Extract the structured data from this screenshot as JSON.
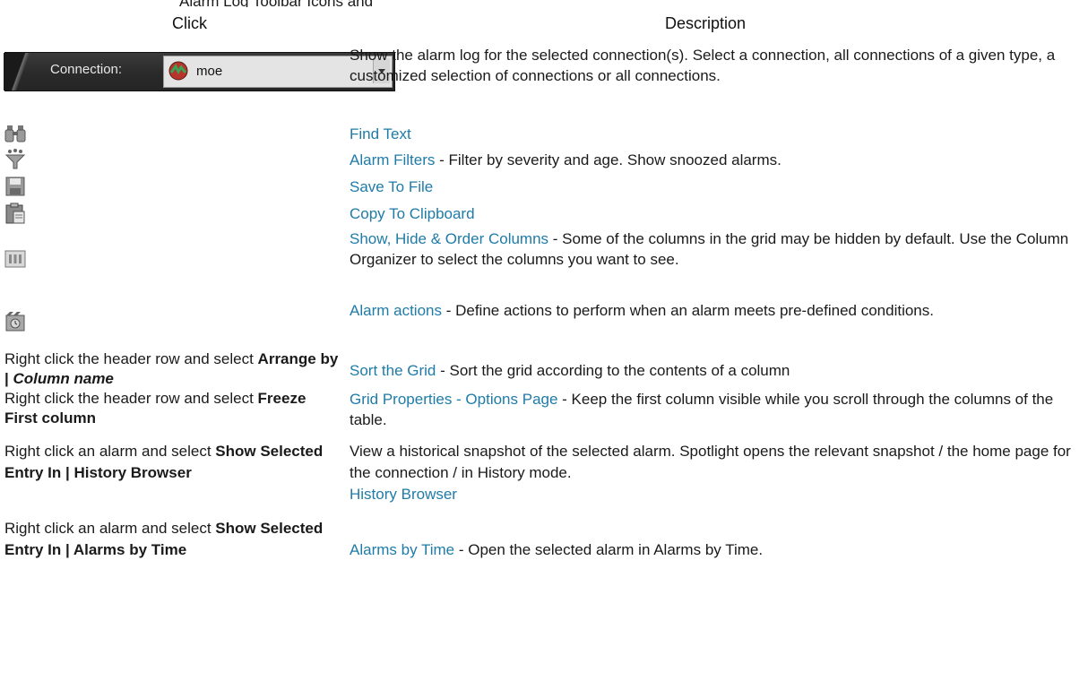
{
  "top_partial_text": "Alarm Log Toolbar Icons and Right-Click Actions",
  "headers": {
    "click": "Click",
    "description": "Description"
  },
  "connection": {
    "label": "Connection:",
    "value": "moe"
  },
  "rows": {
    "r0": {
      "desc": "Show the alarm log for the selected connection(s). Select a connection, all connections of a given type, a customized selection of connections or all connections."
    },
    "r1": {
      "icon": "binoculars-icon",
      "link": "Find Text"
    },
    "r2": {
      "icon": "filter-icon",
      "link": "Alarm Filters",
      "rest": " - Filter by severity and age. Show snoozed alarms."
    },
    "r3": {
      "icon": "save-icon",
      "link": "Save To File"
    },
    "r4": {
      "icon": "clipboard-icon",
      "link": "Copy To Clipboard"
    },
    "r5": {
      "icon": "columns-icon",
      "link": "Show, Hide & Order Columns",
      "rest": " - Some of the columns in the grid may be hidden by default. Use the Column Organizer to select the columns you want to see."
    },
    "r6": {
      "icon": "alarm-actions-icon",
      "link": "Alarm actions",
      "rest": " - Define actions to perform when an alarm meets pre-defined conditions."
    },
    "r7": {
      "click_pre": "Right click the header row and select ",
      "click_bold": "Arrange by | ",
      "click_italic": "Column name",
      "link": "Sort the Grid",
      "rest": " - Sort the grid according to the contents of a column"
    },
    "r8": {
      "click_pre": "Right click the header row and select ",
      "click_bold": "Freeze First column",
      "link": "Grid Properties - Options Page",
      "rest": " - Keep the first column visible while you scroll through the columns of the table."
    },
    "r9": {
      "click_pre": "Right click an alarm and select ",
      "click_bold": "Show Selected Entry In | History Browser",
      "desc": "View a historical snapshot of the selected alarm. Spotlight opens the relevant snapshot / the home page for the connection / in History mode.",
      "link": "History Browser"
    },
    "r10": {
      "click_pre": "Right click an alarm and select ",
      "click_bold": "Show Selected Entry In | Alarms by Time",
      "link": "Alarms by Time",
      "rest": " - Open the selected alarm in Alarms by Time."
    }
  }
}
